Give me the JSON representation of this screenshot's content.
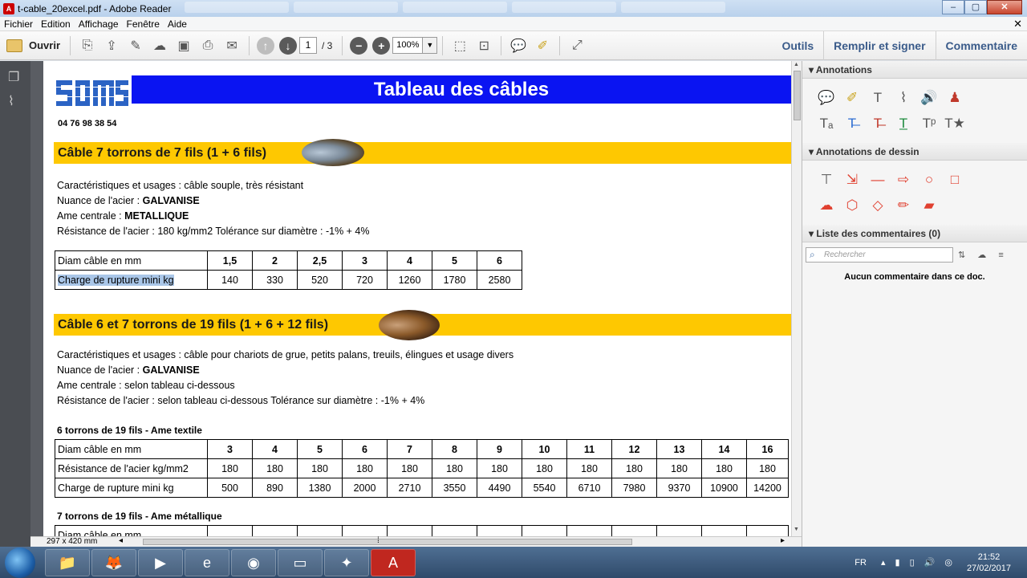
{
  "window": {
    "title": "t-cable_20excel.pdf - Adobe Reader",
    "controls": [
      "–",
      "▢",
      "✕"
    ]
  },
  "menu": [
    "Fichier",
    "Edition",
    "Affichage",
    "Fenêtre",
    "Aide"
  ],
  "toolbar": {
    "open_label": "Ouvrir",
    "page_current": "1",
    "page_total": "/ 3",
    "zoom": "100%",
    "right_links": [
      "Outils",
      "Remplir et signer",
      "Commentaire"
    ]
  },
  "document": {
    "header_title": "Tableau des câbles",
    "phone": "04 76 98 38 54",
    "section1": {
      "title": "Câble 7 torrons de 7 fils (1 + 6 fils)",
      "usage_label": "Caractéristiques et usages : ",
      "usage_value": "câble souple, très résistant",
      "nuance_label": "Nuance de l'acier : ",
      "nuance_value": "GALVANISE",
      "ame_label": "Ame centrale : ",
      "ame_value": "METALLIQUE",
      "resistance_text": "Résistance de l'acier : 180 kg/mm2   Tolérance sur diamètre : -1% + 4%",
      "table": {
        "row1_label": "Diam câble en mm",
        "diameters": [
          "1,5",
          "2",
          "2,5",
          "3",
          "4",
          "5",
          "6"
        ],
        "row2_label": "Charge de rupture mini kg",
        "loads": [
          "140",
          "330",
          "520",
          "720",
          "1260",
          "1780",
          "2580"
        ]
      }
    },
    "section2": {
      "title": "Câble 6 et 7 torrons de 19 fils (1 + 6 + 12 fils)",
      "usage_label": "Caractéristiques et usages : ",
      "usage_value": "câble pour chariots de grue, petits palans, treuils, élingues et usage divers",
      "nuance_label": "Nuance de l'acier : ",
      "nuance_value": "GALVANISE",
      "ame_text": "Ame centrale : selon tableau ci-dessous",
      "resistance_text": "Résistance de l'acier : selon tableau ci-dessous   Tolérance sur diamètre : -1% + 4%",
      "sub1_title": "6 torrons de 19 fils - Ame textile",
      "table": {
        "row1_label": "Diam câble en mm",
        "diameters": [
          "3",
          "4",
          "5",
          "6",
          "7",
          "8",
          "9",
          "10",
          "11",
          "12",
          "13",
          "14",
          "16"
        ],
        "row2_label": "Résistance de l'acier kg/mm2",
        "resistances": [
          "180",
          "180",
          "180",
          "180",
          "180",
          "180",
          "180",
          "180",
          "180",
          "180",
          "180",
          "180",
          "180"
        ],
        "row3_label": "Charge de rupture mini kg",
        "loads": [
          "500",
          "890",
          "1380",
          "2000",
          "2710",
          "3550",
          "4490",
          "5540",
          "6710",
          "7980",
          "9370",
          "10900",
          "14200"
        ]
      },
      "sub2_title": "7 torrons de 19 fils - Ame métallique",
      "sub2_row_label": "Diam câble en mm"
    },
    "page_size": "297 x 420 mm"
  },
  "right_panel": {
    "annotations_title": "Annotations",
    "drawing_title": "Annotations de dessin",
    "comments_title": "Liste des commentaires (0)",
    "search_placeholder": "Rechercher",
    "no_comments": "Aucun commentaire dans ce doc."
  },
  "taskbar": {
    "lang": "FR",
    "time": "21:52",
    "date": "27/02/2017"
  },
  "colors": {
    "title_band": "#0a14f2",
    "section_band": "#fec801",
    "selection": "#a9c6e8"
  }
}
